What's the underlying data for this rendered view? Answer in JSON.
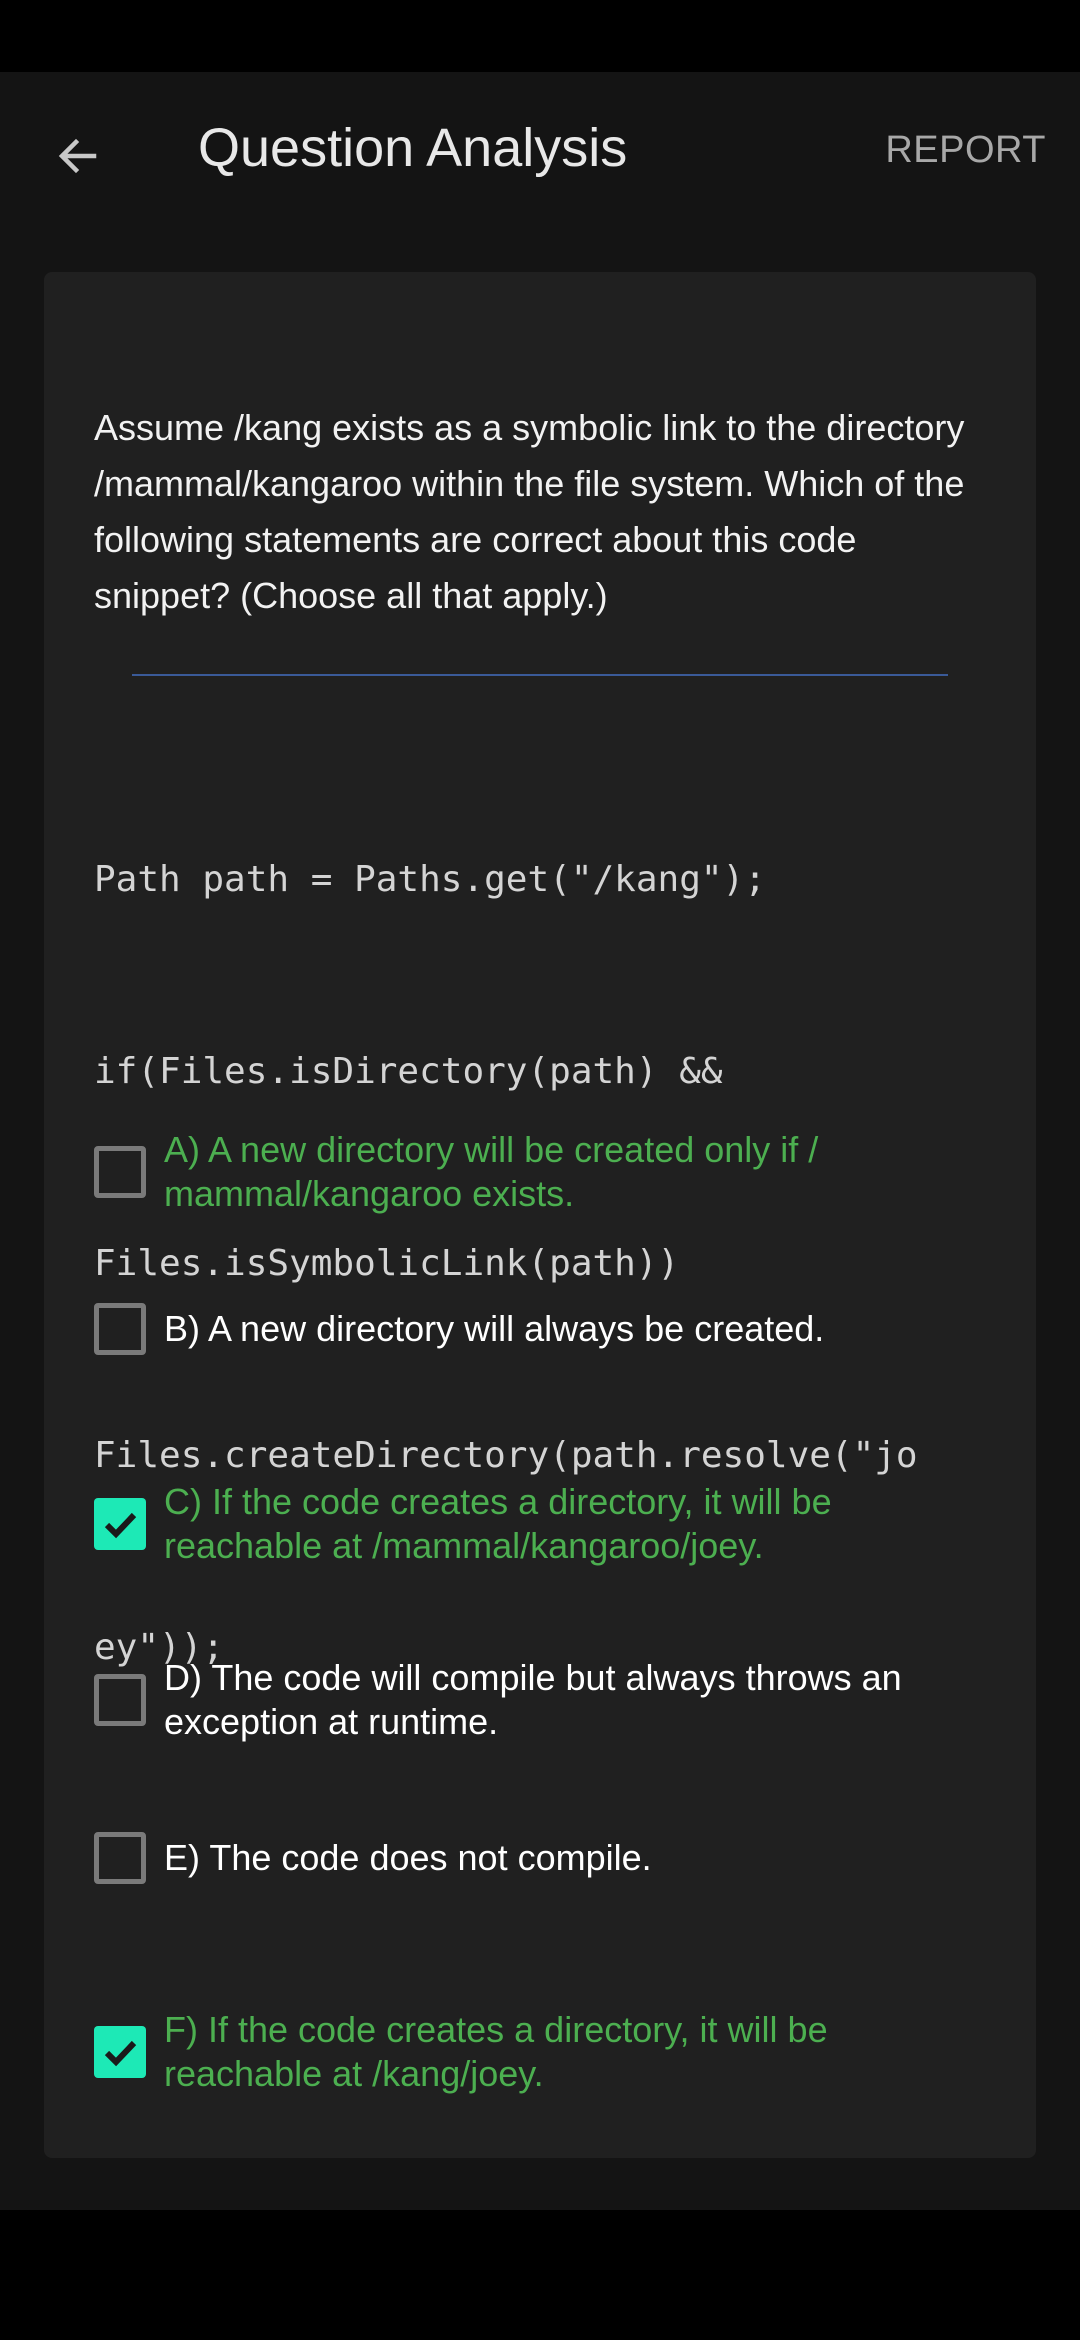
{
  "header": {
    "title": "Question Analysis",
    "report_label": "REPORT",
    "back_icon": "arrow-left-icon"
  },
  "question": {
    "text": "Assume /kang exists as a symbolic link to the directory /mammal/kangaroo within the file system. Which of the following statements are correct about this code snippet? (Choose all that apply.)",
    "code_lines": [
      "Path path = Paths.get(\"/kang\");",
      "if(Files.isDirectory(path) &&",
      "Files.isSymbolicLink(path))",
      "Files.createDirectory(path.resolve(\"jo",
      "ey\"));"
    ]
  },
  "options": [
    {
      "text": "A) A new directory will be created only if /\nmammal/kangaroo exists.",
      "checked": false,
      "correct": true
    },
    {
      "text": "B) A new directory will always be created.",
      "checked": false,
      "correct": false
    },
    {
      "text": "C) If the code creates a directory, it will be\nreachable at /mammal/kangaroo/joey.",
      "checked": true,
      "correct": true
    },
    {
      "text": "D) The code will compile but always throws an\nexception at runtime.",
      "checked": false,
      "correct": false
    },
    {
      "text": "E) The code does not compile.",
      "checked": false,
      "correct": false
    },
    {
      "text": "F) If the code creates a directory, it will be\nreachable at /kang/joey.",
      "checked": true,
      "correct": true
    }
  ],
  "colors": {
    "background": "#141414",
    "card": "#202020",
    "correct_text": "#4caf50",
    "checkbox_checked": "#1de9b6",
    "divider": "#3a5a98"
  }
}
